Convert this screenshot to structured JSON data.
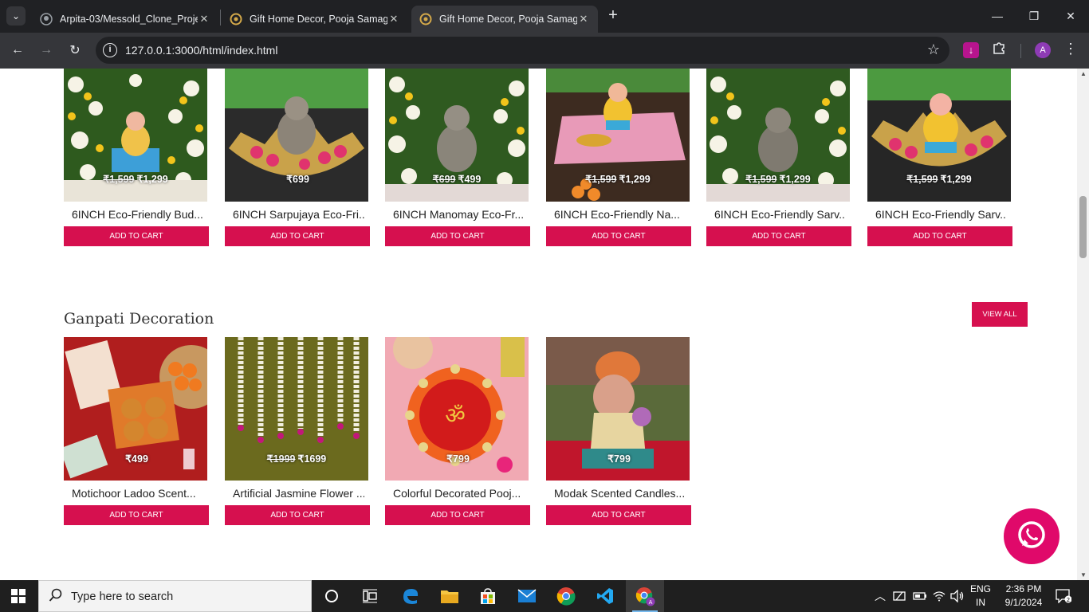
{
  "browser": {
    "tabs": [
      {
        "title": "Arpita-03/Messold_Clone_Proje"
      },
      {
        "title": "Gift Home Decor, Pooja Samagri"
      },
      {
        "title": "Gift Home Decor, Pooja Samagri"
      }
    ],
    "url": "127.0.0.1:3000/html/index.html",
    "profile_initial": "A"
  },
  "top_products": [
    {
      "old_price": "₹1,599",
      "price": "₹1,299",
      "name": "6INCH Eco-Friendly Bud...",
      "button": "ADD TO CART"
    },
    {
      "old_price": "",
      "price": "₹699",
      "name": "6INCH Sarpujaya Eco-Fri...",
      "button": "ADD TO CART"
    },
    {
      "old_price": "₹699",
      "price": "₹499",
      "name": "6INCH Manomay Eco-Fr...",
      "button": "ADD TO CART"
    },
    {
      "old_price": "₹1,599",
      "price": "₹1,299",
      "name": "6INCH Eco-Friendly Na...",
      "button": "ADD TO CART"
    },
    {
      "old_price": "₹1,599",
      "price": "₹1,299",
      "name": "6INCH Eco-Friendly Sarv...",
      "button": "ADD TO CART"
    },
    {
      "old_price": "₹1,599",
      "price": "₹1,299",
      "name": "6INCH Eco-Friendly Sarv...",
      "button": "ADD TO CART"
    }
  ],
  "section": {
    "title": "Ganpati Decoration",
    "view_all": "VIEW ALL"
  },
  "decoration_products": [
    {
      "old_price": "",
      "price": "₹499",
      "name": "Motichoor Ladoo Scent...",
      "button": "ADD TO CART"
    },
    {
      "old_price": "₹1999",
      "price": "₹1699",
      "name": "Artificial Jasmine Flower ...",
      "button": "ADD TO CART"
    },
    {
      "old_price": "",
      "price": "₹799",
      "name": "Colorful Decorated Pooj...",
      "button": "ADD TO CART"
    },
    {
      "old_price": "",
      "price": "₹799",
      "name": "Modak Scented Candles...",
      "button": "ADD TO CART"
    }
  ],
  "taskbar": {
    "search_placeholder": "Type here to search",
    "lang": "ENG",
    "region": "IN",
    "time": "2:36 PM",
    "date": "9/1/2024"
  },
  "colors": {
    "accent": "#d6104f",
    "whatsapp": "#e0096a"
  }
}
